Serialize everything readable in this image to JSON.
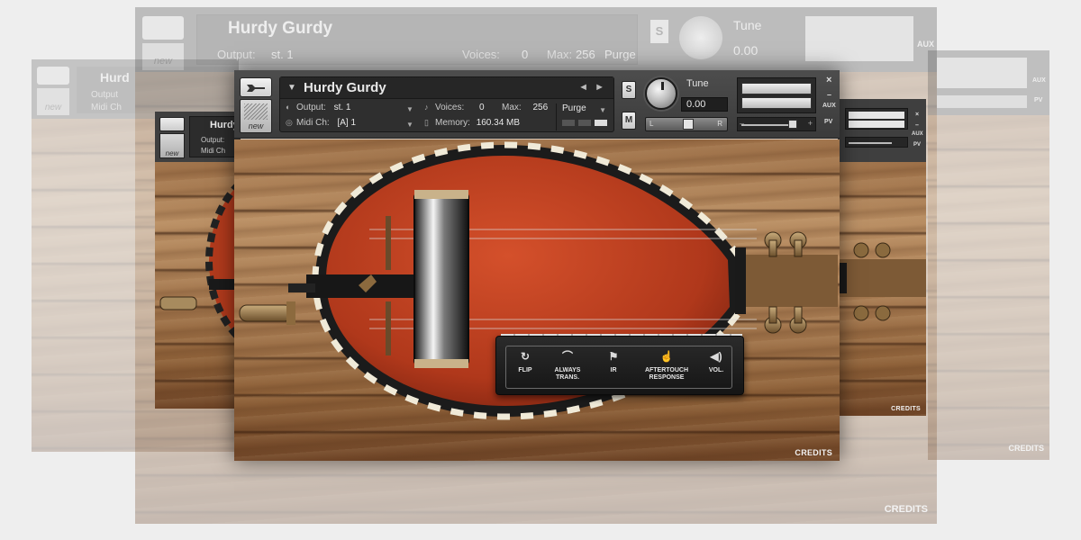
{
  "colors": {
    "page_background": "#eeeeee",
    "header": "#444444",
    "instrument_body": "#c0391b",
    "wood": "#a57950"
  },
  "header": {
    "instrument_name": "Hurdy Gurdy",
    "output_label": "Output:",
    "output_value": "st. 1",
    "voices_label": "Voices:",
    "voices_value": "0",
    "max_label": "Max:",
    "max_value": "256",
    "purge_label": "Purge",
    "midi_label": "Midi Ch:",
    "midi_value": "[A] 1",
    "memory_label": "Memory:",
    "memory_value": "160.34 MB",
    "new_label": "new",
    "solo_label": "S",
    "mute_label": "M",
    "tune_label": "Tune",
    "tune_value": "0.00",
    "pan_left": "L",
    "pan_right": "R",
    "aux_label": "AUX",
    "pv_label": "PV",
    "close_glyph": "×",
    "minimize_glyph": "–",
    "nav_prev_glyph": "◄",
    "nav_next_glyph": "►",
    "dropdown_glyph": "▼"
  },
  "ghost_far": {
    "instrument_name": "Hurdy Gurdy",
    "output_label": "Output:",
    "output_value": "st. 1",
    "voices_label": "Voices:",
    "voices_value": "0",
    "max_label": "Max:",
    "max_value": "256",
    "purge_label": "Purge",
    "solo_label": "S",
    "tune_label": "Tune",
    "tune_value": "0.00",
    "aux_label": "AUX",
    "new_label": "new",
    "credits": "CREDITS"
  },
  "ghost_left": {
    "instrument_name": "Hurd",
    "output_label": "Output",
    "midi_label": "Midi Ch",
    "new_label": "new"
  },
  "side_left": {
    "instrument_name": "Hurdy",
    "output_label": "Output:",
    "midi_label": "Midi Ch",
    "new_label": "new"
  },
  "side_right": {
    "aux_label": "AUX",
    "pv_label": "PV",
    "credits": "CREDITS"
  },
  "ghost_right": {
    "aux_label": "AUX",
    "pv_label": "PV",
    "credits": "CREDITS"
  },
  "controls": [
    {
      "label_line1": "FLIP",
      "label_line2": "",
      "icon": "flip-icon"
    },
    {
      "label_line1": "ALWAYS",
      "label_line2": "TRANS.",
      "icon": "arc-icon"
    },
    {
      "label_line1": "IR",
      "label_line2": "",
      "icon": "flag-icon"
    },
    {
      "label_line1": "AFTERTOUCH",
      "label_line2": "RESPONSE",
      "icon": "finger-icon"
    },
    {
      "label_line1": "VOL.",
      "label_line2": "",
      "icon": "speaker-icon"
    }
  ],
  "credits": "CREDITS"
}
